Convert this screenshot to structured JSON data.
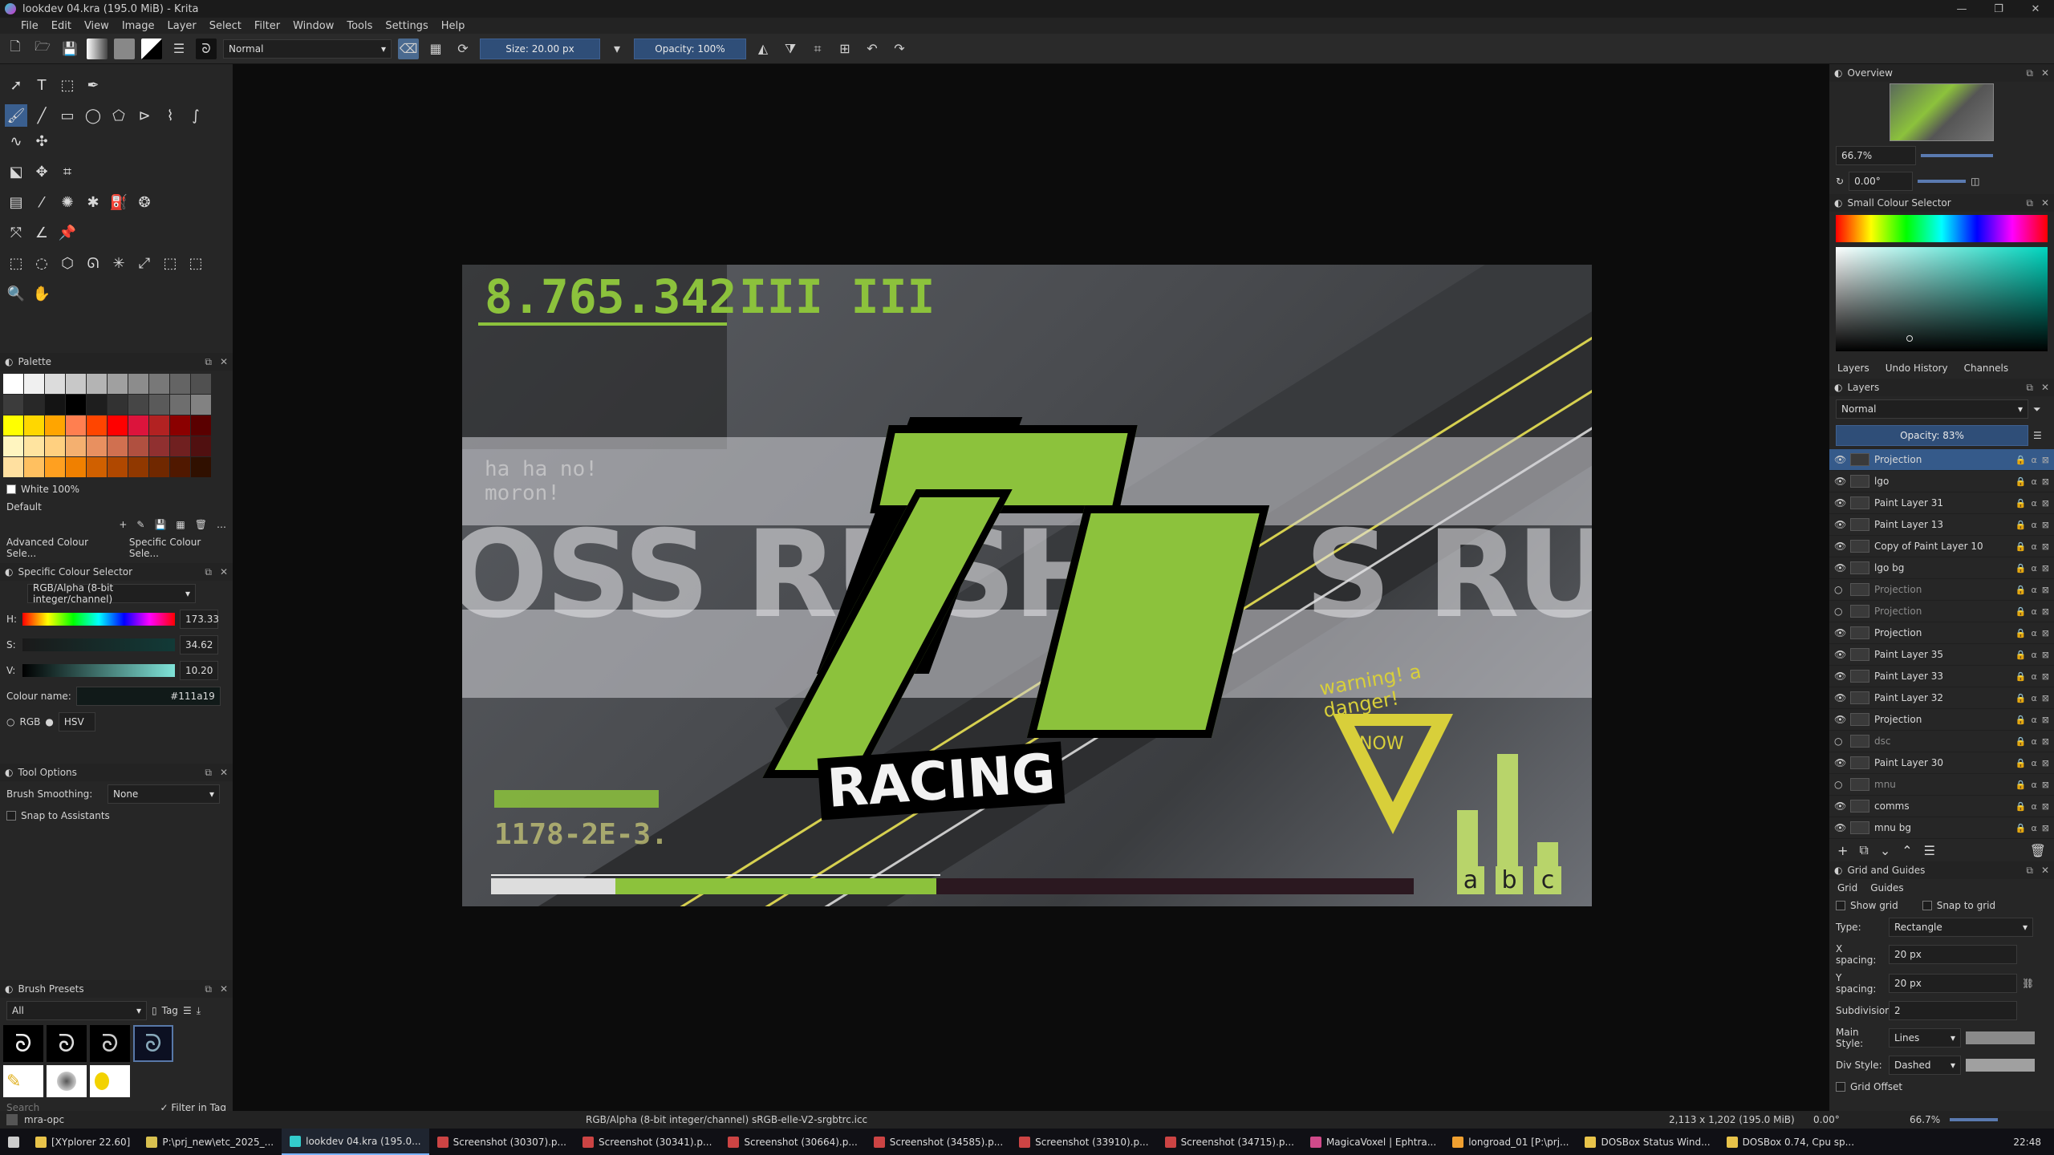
{
  "window": {
    "title": "lookdev 04.kra (195.0 MiB) - Krita"
  },
  "menu": [
    "File",
    "Edit",
    "View",
    "Image",
    "Layer",
    "Select",
    "Filter",
    "Window",
    "Tools",
    "Settings",
    "Help"
  ],
  "toolbar": {
    "blend_mode": "Normal",
    "size_label": "Size: 20.00 px",
    "opacity_label": "Opacity: 100%"
  },
  "palette": {
    "title": "Palette",
    "current_color": "White 100%",
    "palette_name": "Default",
    "colors": [
      "#ffffff",
      "#f0f0f0",
      "#dcdcdc",
      "#c8c8c8",
      "#b4b4b4",
      "#a0a0a0",
      "#8c8c8c",
      "#787878",
      "#646464",
      "#505050",
      "#3c3c3c",
      "#282828",
      "#141414",
      "#000000",
      "#1e1e1e",
      "#323232",
      "#464646",
      "#5a5a5a",
      "#6e6e6e",
      "#828282",
      "#ffff00",
      "#ffd700",
      "#ffa500",
      "#ff7f50",
      "#ff4500",
      "#ff0000",
      "#dc143c",
      "#b22222",
      "#8b0000",
      "#5a0000",
      "#fff5c0",
      "#ffe4a0",
      "#ffd080",
      "#f4b070",
      "#e89060",
      "#d07050",
      "#b05040",
      "#903030",
      "#702020",
      "#501010",
      "#ffe0a0",
      "#ffc060",
      "#ffa020",
      "#f08000",
      "#d06000",
      "#b04800",
      "#903800",
      "#702800",
      "#501800",
      "#301000"
    ],
    "tabs": [
      "Advanced Colour Sele...",
      "Specific Colour Sele..."
    ]
  },
  "specific_colour": {
    "title": "Specific Colour Selector",
    "profile": "RGB/Alpha (8-bit integer/channel)",
    "h_label": "H:",
    "h_value": "173.33",
    "s_label": "S:",
    "s_value": "34.62",
    "v_label": "V:",
    "v_value": "10.20",
    "colour_name_label": "Colour name:",
    "colour_name_value": "#111a19",
    "rgb_label": "RGB",
    "hsv_label": "HSV"
  },
  "tool_options": {
    "title": "Tool Options",
    "smoothing_label": "Brush Smoothing:",
    "smoothing_value": "None",
    "snap_label": "Snap to Assistants"
  },
  "brush_presets": {
    "title": "Brush Presets",
    "filter": "All",
    "tag_label": "Tag",
    "search_placeholder": "Search",
    "filter_in_tag": "Filter in Tag"
  },
  "artwork": {
    "score": "8.765.342",
    "bars": "III III",
    "small_num": "1178-2E-3.",
    "racing": "RACING",
    "warn": "warning! a danger!",
    "now": "NOW",
    "abc": [
      "a",
      "b",
      "c"
    ],
    "big_text_left": "OSS RUSH",
    "big_text_right": "S RUS",
    "scribble": "ha ha no! moron!"
  },
  "overview": {
    "title": "Overview",
    "zoom": "66.7%",
    "rotate": "0.00°"
  },
  "small_colour": {
    "title": "Small Colour Selector"
  },
  "layers": {
    "tabs": [
      "Layers",
      "Undo History",
      "Channels"
    ],
    "title": "Layers",
    "blend_mode": "Normal",
    "opacity": "Opacity: 83%",
    "items": [
      {
        "name": "Projection",
        "selected": true,
        "dim": false
      },
      {
        "name": "lgo",
        "selected": false,
        "dim": false
      },
      {
        "name": "Paint Layer 31",
        "selected": false,
        "dim": false
      },
      {
        "name": "Paint Layer 13",
        "selected": false,
        "dim": false
      },
      {
        "name": "Copy of Paint Layer 10",
        "selected": false,
        "dim": false
      },
      {
        "name": "lgo bg",
        "selected": false,
        "dim": false
      },
      {
        "name": "Projection",
        "selected": false,
        "dim": true
      },
      {
        "name": "Projection",
        "selected": false,
        "dim": true
      },
      {
        "name": "Projection",
        "selected": false,
        "dim": false
      },
      {
        "name": "Paint Layer 35",
        "selected": false,
        "dim": false
      },
      {
        "name": "Paint Layer 33",
        "selected": false,
        "dim": false
      },
      {
        "name": "Paint Layer 32",
        "selected": false,
        "dim": false
      },
      {
        "name": "Projection",
        "selected": false,
        "dim": false
      },
      {
        "name": "dsc",
        "selected": false,
        "dim": true
      },
      {
        "name": "Paint Layer 30",
        "selected": false,
        "dim": false
      },
      {
        "name": "mnu",
        "selected": false,
        "dim": true
      },
      {
        "name": "comms",
        "selected": false,
        "dim": false
      },
      {
        "name": "mnu bg",
        "selected": false,
        "dim": false
      }
    ]
  },
  "grid": {
    "title": "Grid and Guides",
    "tabs": [
      "Grid",
      "Guides"
    ],
    "show_grid": "Show grid",
    "snap_grid": "Snap to grid",
    "type_label": "Type:",
    "type_value": "Rectangle",
    "x_label": "X spacing:",
    "x_value": "20 px",
    "y_label": "Y spacing:",
    "y_value": "20 px",
    "sub_label": "Subdivision:",
    "sub_value": "2",
    "main_label": "Main Style:",
    "main_value": "Lines",
    "div_label": "Div Style:",
    "div_value": "Dashed",
    "offset_label": "Grid Offset"
  },
  "status": {
    "brush": "mra-opc",
    "profile": "RGB/Alpha (8-bit integer/channel)  sRGB-elle-V2-srgbtrc.icc",
    "dims": "2,113 x 1,202 (195.0 MiB)",
    "rotation": "0.00°",
    "zoom": "66.7%"
  },
  "taskbar": {
    "items": [
      "[XYplorer 22.60]",
      "P:\\prj_new\\etc_2025_...",
      "lookdev 04.kra (195.0...",
      "Screenshot (30307).p...",
      "Screenshot (30341).p...",
      "Screenshot (30664).p...",
      "Screenshot (34585).p...",
      "Screenshot (33910).p...",
      "Screenshot (34715).p...",
      "MagicaVoxel | Ephtra...",
      "longroad_01 [P:\\prj...",
      "DOSBox Status Wind...",
      "DOSBox 0.74, Cpu sp..."
    ],
    "time": "22:48"
  }
}
